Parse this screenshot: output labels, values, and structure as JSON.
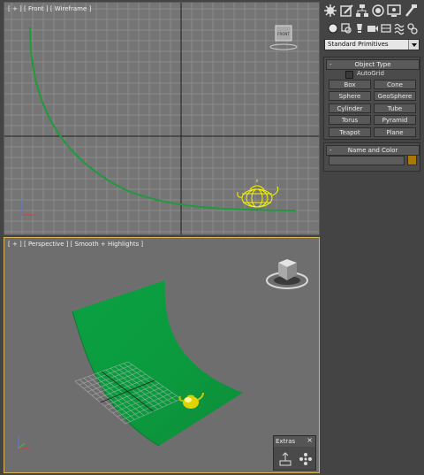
{
  "viewports": {
    "front": {
      "label": "[ + ] [ Front ] [ Wireframe ]",
      "viewcube_label": "FRONT"
    },
    "perspective": {
      "label": "[ + ] [ Perspective ] [ Smooth + Highlights ]"
    }
  },
  "command_panel": {
    "tabs": [
      "create-icon",
      "modify-icon",
      "hierarchy-icon",
      "motion-icon",
      "display-icon",
      "utilities-icon"
    ],
    "subtabs": [
      "geometry-icon",
      "shapes-icon",
      "lights-icon",
      "cameras-icon",
      "helpers-icon",
      "spacewarps-icon",
      "systems-icon"
    ],
    "category_dropdown": "Standard Primitives",
    "object_type": {
      "title": "Object Type",
      "collapse_symbol": "-",
      "autogrid_label": "AutoGrid",
      "buttons": [
        "Box",
        "Cone",
        "Sphere",
        "GeoSphere",
        "Cylinder",
        "Tube",
        "Torus",
        "Pyramid",
        "Teapot",
        "Plane"
      ]
    },
    "name_and_color": {
      "title": "Name and Color",
      "collapse_symbol": "-",
      "name_value": "",
      "color": "#a87800"
    }
  },
  "extras": {
    "title": "Extras",
    "close_symbol": "×"
  },
  "colors": {
    "accent_yellow": "#f5f500",
    "backdrop_green": "#0f9e3c",
    "viewport_bg": "#757575"
  }
}
